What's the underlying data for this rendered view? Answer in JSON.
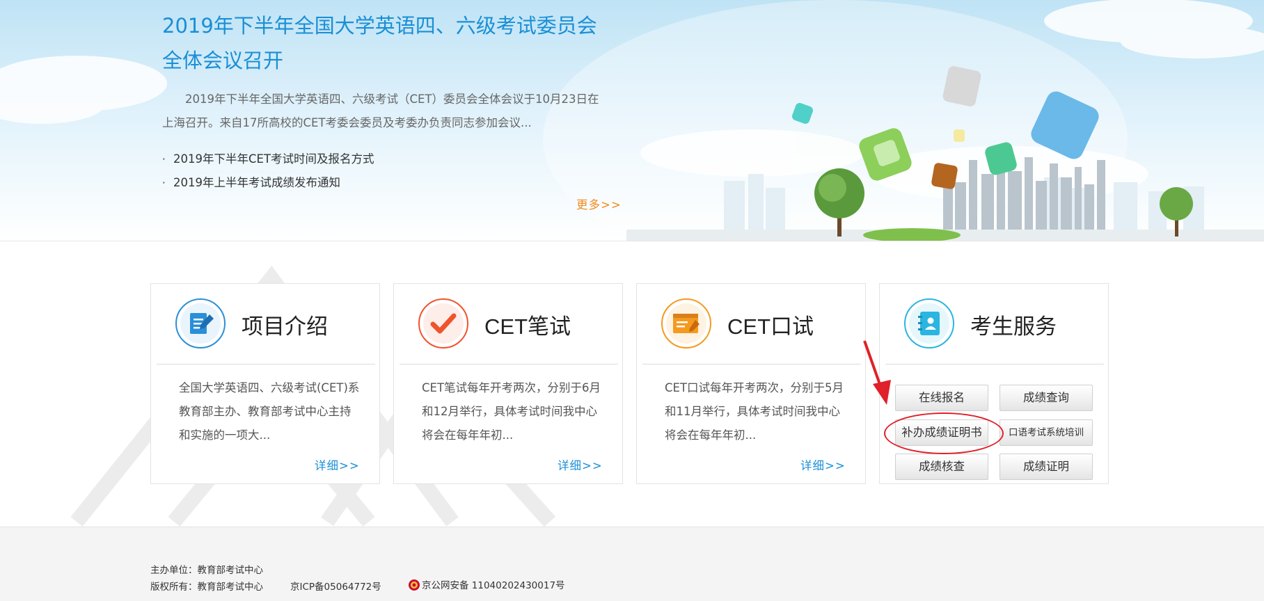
{
  "hero": {
    "title": "2019年下半年全国大学英语四、六级考试委员会全体会议召开",
    "description": "2019年下半年全国大学英语四、六级考试（CET）委员会全体会议于10月23日在上海召开。来自17所高校的CET考委会委员及考委办负责同志参加会议...",
    "links": [
      "2019年下半年CET考试时间及报名方式",
      "2019年上半年考试成绩发布通知"
    ],
    "more": "更多>>"
  },
  "cards": [
    {
      "title": "项目介绍",
      "body": "全国大学英语四、六级考试(CET)系教育部主办、教育部考试中心主持和实施的一项大...",
      "more": "详细>>",
      "icon": "document-edit-icon",
      "color": "#2a8fd8"
    },
    {
      "title": "CET笔试",
      "body": "CET笔试每年开考两次，分别于6月和12月举行，具体考试时间我中心将会在每年年初...",
      "more": "详细>>",
      "icon": "checkmark-icon",
      "color": "#f0542c"
    },
    {
      "title": "CET口试",
      "body": "CET口试每年开考两次，分别于5月和11月举行，具体考试时间我中心将会在每年年初...",
      "more": "详细>>",
      "icon": "screen-edit-icon",
      "color": "#f59a1e"
    },
    {
      "title": "考生服务",
      "icon": "contact-book-icon",
      "color": "#2bb5e0"
    }
  ],
  "services": {
    "online_signup": "在线报名",
    "score_query": "成绩查询",
    "reissue_certificate": "补办成绩证明书",
    "oral_training": "口语考试系统培训",
    "score_review": "成绩核查",
    "score_certificate": "成绩证明"
  },
  "footer": {
    "sponsor": "主办单位：教育部考试中心",
    "copyright": "版权所有：教育部考试中心",
    "icp": "京ICP备05064772号",
    "police": "京公网安备 11040202430017号"
  }
}
